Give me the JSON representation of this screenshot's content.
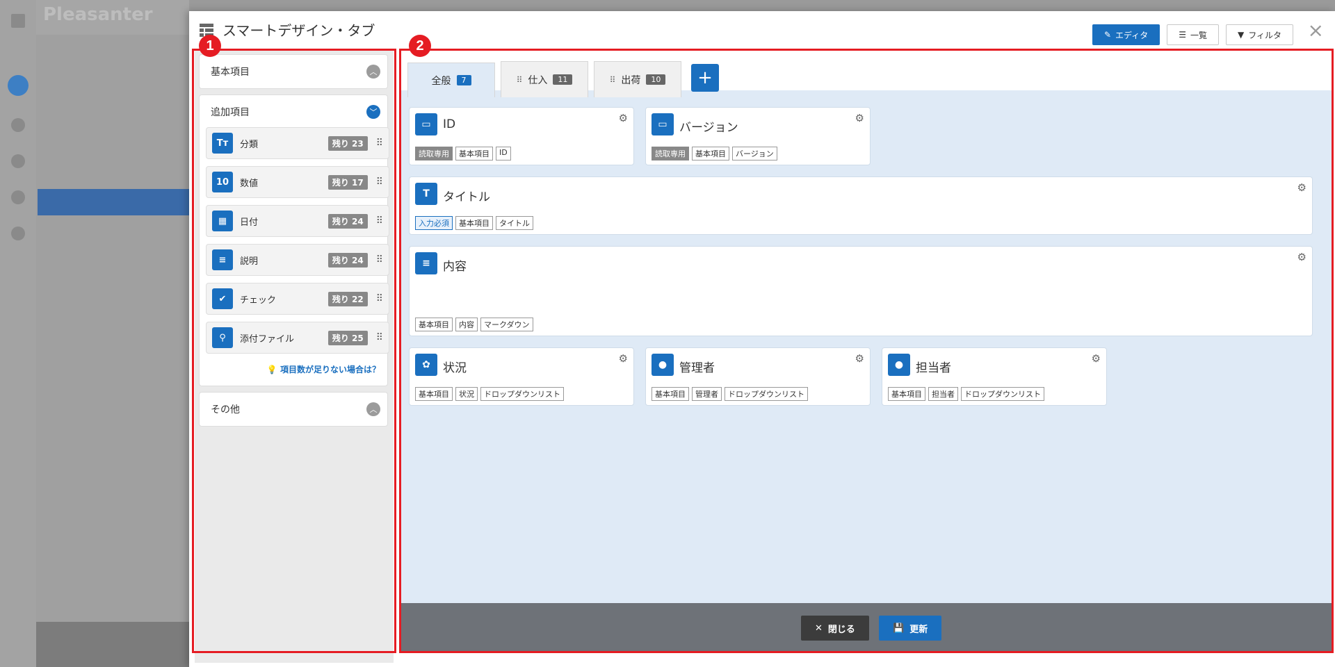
{
  "background": {
    "logo": "Pleasanter"
  },
  "dialog": {
    "title": "スマートデザイン・タブ",
    "header_buttons": [
      {
        "label": "エディタ",
        "icon": "edit-icon"
      },
      {
        "label": "一覧",
        "icon": "list-icon"
      },
      {
        "label": "フィルタ",
        "icon": "filter-icon"
      }
    ],
    "close_icon": "×"
  },
  "left_panel": {
    "sections": [
      {
        "label": "基本項目",
        "state": "collapsed"
      },
      {
        "label": "追加項目",
        "state": "expanded"
      },
      {
        "label": "その他",
        "state": "collapsed"
      }
    ],
    "items": [
      {
        "icon": "Tт",
        "label": "分類",
        "remain": "残り 23"
      },
      {
        "icon": "10",
        "label": "数値",
        "remain": "残り 17"
      },
      {
        "icon": "▦",
        "label": "日付",
        "remain": "残り 24"
      },
      {
        "icon": "≡",
        "label": "説明",
        "remain": "残り 24"
      },
      {
        "icon": "✔",
        "label": "チェック",
        "remain": "残り 22"
      },
      {
        "icon": "⚲",
        "label": "添付ファイル",
        "remain": "残り 25"
      }
    ],
    "help_link": "項目数が足りない場合は？",
    "grip": "⠿"
  },
  "right_panel": {
    "tabs": [
      {
        "label": "全般",
        "count": "7",
        "active": true
      },
      {
        "label": "仕入",
        "count": "11"
      },
      {
        "label": "出荷",
        "count": "10"
      }
    ],
    "add_tab": "+",
    "cards": [
      {
        "title": "ID",
        "icon": "▭",
        "tags": [
          "読取専用",
          "基本項目",
          "ID"
        ]
      },
      {
        "title": "バージョン",
        "icon": "▭",
        "tags": [
          "読取専用",
          "基本項目",
          "バージョン"
        ]
      },
      {
        "title": "タイトル",
        "icon": "T",
        "tags": [
          "入力必須",
          "基本項目",
          "タイトル"
        ]
      },
      {
        "title": "内容",
        "icon": "≡",
        "tags": [
          "基本項目",
          "内容",
          "マークダウン"
        ]
      },
      {
        "title": "状況",
        "icon": "✿",
        "tags": [
          "基本項目",
          "状況",
          "ドロップダウンリスト"
        ]
      },
      {
        "title": "管理者",
        "icon": "●",
        "tags": [
          "基本項目",
          "管理者",
          "ドロップダウンリスト"
        ]
      },
      {
        "title": "担当者",
        "icon": "●",
        "tags": [
          "基本項目",
          "担当者",
          "ドロップダウンリスト"
        ]
      }
    ],
    "gear": "⚙"
  },
  "footer": {
    "close_label": "閉じる",
    "update_label": "更新"
  },
  "annotations": [
    "1",
    "2"
  ],
  "colors": {
    "accent": "#1a6fbf",
    "highlight": "#e51c23",
    "panel_bg": "#dfeaf6"
  }
}
